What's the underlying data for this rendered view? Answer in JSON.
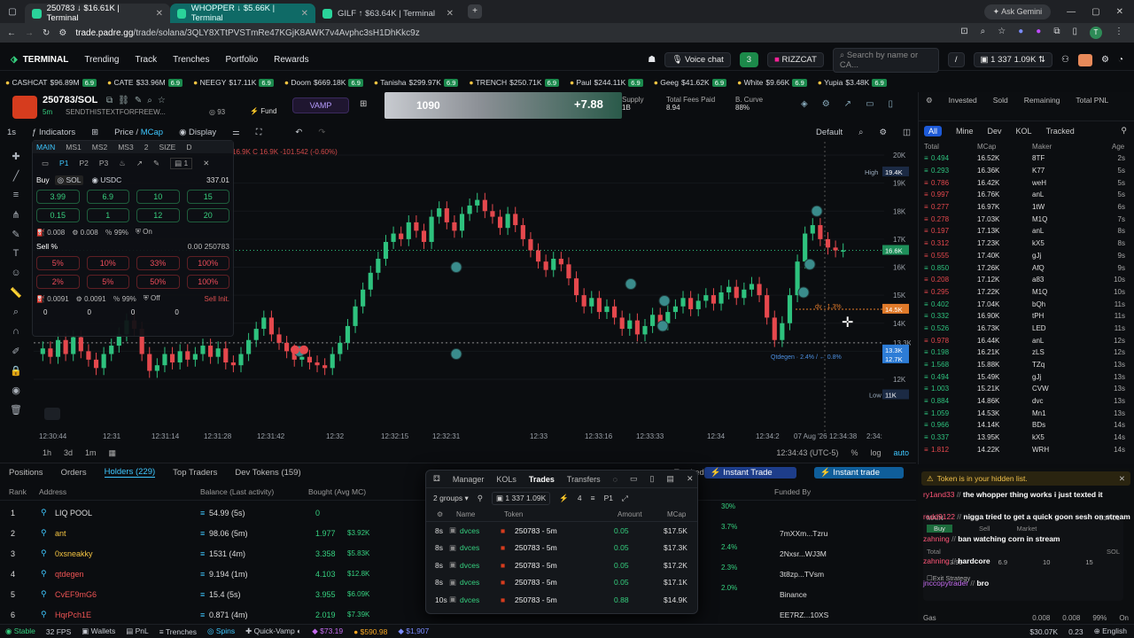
{
  "browser": {
    "tabs": [
      {
        "label": "250783 ↓ $16.61K | Terminal"
      },
      {
        "label": "WHOPPER ↓ $5.66K | Terminal"
      },
      {
        "label": "GILF ↑ $63.64K | Terminal"
      }
    ],
    "address_host": "trade.padre.gg",
    "address_path": "/trade/solana/3QLY8XTtPVSTmRe47KGjK8AWK7v4Avphc3sH1DhKkc9z",
    "ask_gemini": "Ask Gemini"
  },
  "nav": {
    "brand": "TERMINAL",
    "items": [
      "Trending",
      "Track",
      "Trenches",
      "Portfolio",
      "Rewards"
    ],
    "voice_chat": "Voice chat",
    "badge_count": "3",
    "profile_name": "RIZZCAT",
    "search_placeholder": "Search by name or CA...",
    "search_shortcut": "/",
    "wallet_count": "1",
    "sol_amount": "337",
    "usd_amount": "1.09K"
  },
  "ticker": [
    {
      "name": "CASHCAT",
      "mcap": "$96.89M",
      "pct": "6.9",
      "dir": "up"
    },
    {
      "name": "CATE",
      "mcap": "$33.96M",
      "pct": "6.9",
      "dir": "up"
    },
    {
      "name": "NEEGY",
      "mcap": "$17.11K",
      "pct": "6.9",
      "dir": "up"
    },
    {
      "name": "Doom",
      "mcap": "$669.18K",
      "pct": "6.9",
      "dir": "up"
    },
    {
      "name": "Tanisha",
      "mcap": "$299.97K",
      "pct": "6.9",
      "dir": "up"
    },
    {
      "name": "TRENCH",
      "mcap": "$250.71K",
      "pct": "6.9",
      "dir": "up"
    },
    {
      "name": "Paul",
      "mcap": "$244.11K",
      "pct": "6.9",
      "dir": "up"
    },
    {
      "name": "Geeg",
      "mcap": "$41.62K",
      "pct": "6.9",
      "dir": "up"
    },
    {
      "name": "White",
      "mcap": "$9.66K",
      "pct": "6.9",
      "dir": "up"
    },
    {
      "name": "Yupia",
      "mcap": "$3.48K",
      "pct": "6.9",
      "dir": "up"
    }
  ],
  "token": {
    "pair": "250783/SOL",
    "age": "5m",
    "ticker_line": "SENDTHISTEXTFORFREEW...",
    "holders_icon_count": "93",
    "fund": "Fund",
    "vamp": "VAMP",
    "overlay_value": "1090",
    "overlay_pct": "+7.88",
    "supply_label": "Supply",
    "supply_value": "1B",
    "fees_label": "Total Fees Paid",
    "fees_value": "8.94",
    "curve_label": "B. Curve",
    "curve_value": "88%"
  },
  "chart_toolbar": {
    "interval": "1s",
    "indicators": "Indicators",
    "price": "Price",
    "mcap": "MCap",
    "display": "Display",
    "default": "Default",
    "ohlc": "16.9K C 16.9K -101.542 (-0.60%)"
  },
  "chart_data": {
    "type": "candlestick",
    "y_ticks": [
      "20K",
      "19K",
      "18K",
      "17K",
      "16K",
      "15K",
      "14K",
      "13.3K",
      "13K",
      "12K"
    ],
    "x_ticks": [
      "12:30:44",
      "12:31",
      "12:31:14",
      "12:31:28",
      "12:31:42",
      "12:32",
      "12:32:15",
      "12:32:31",
      "12:33",
      "12:33:16",
      "12:33:33",
      "12:34",
      "12:34:2",
      "07 Aug '26",
      "12:34:38",
      "2:34:"
    ],
    "high_label": "High",
    "high_value": "19.4K",
    "low_label": "Low",
    "low_value": "11K",
    "current_price": "16.6K",
    "dev_line_label": "dv · 1.3%",
    "dev_line_price": "14.5K",
    "qtdegen_label": "Qtdegen · 2.4% / ← 0.8%",
    "blue_tag_1": "13.3K",
    "blue_tag_2": "12.7K",
    "utc_time": "12:34:43 (UTC-5)",
    "timeframes": [
      "1h",
      "3d",
      "1m"
    ],
    "log_label": "log",
    "auto_label": "auto",
    "pct_label": "%",
    "close_series": [
      13.1,
      12.8,
      13.4,
      12.9,
      13.5,
      13.0,
      12.7,
      12.4,
      12.9,
      13.2,
      13.6,
      14.1,
      13.8,
      12.9,
      12.3,
      12.5,
      12.9,
      12.6,
      13.0,
      12.7,
      12.9,
      13.2,
      12.8,
      13.1,
      12.6,
      12.5,
      12.9,
      13.4,
      13.8,
      14.2,
      13.6,
      13.3,
      13.0,
      12.7,
      12.8,
      12.6,
      12.5,
      12.4,
      12.9,
      13.3,
      13.9,
      14.6,
      15.2,
      15.8,
      16.3,
      16.9,
      17.2,
      17.0,
      17.6,
      17.3,
      16.9,
      17.8,
      18.1,
      17.6,
      17.3,
      17.9,
      18.2,
      18.4,
      18.0,
      17.8,
      17.4,
      17.9,
      17.5,
      17.0,
      16.6,
      16.2,
      15.9,
      16.3,
      16.1,
      15.6,
      15.0,
      14.6,
      14.9,
      14.4,
      14.6,
      14.2,
      13.8,
      14.1,
      13.6,
      13.9,
      14.3,
      14.0,
      14.4,
      14.6,
      14.9,
      14.5,
      14.8,
      15.0,
      14.7,
      15.1,
      15.3,
      14.9,
      15.2,
      15.4,
      15.0,
      14.2,
      13.4,
      14.0,
      15.0,
      16.2,
      17.2,
      17.5,
      17.0,
      16.7,
      16.6,
      16.6
    ]
  },
  "trade_panel": {
    "tabs": [
      "MAIN",
      "MS1",
      "MS2",
      "MS3",
      "2",
      "SIZE",
      "D"
    ],
    "presets": [
      "P1",
      "P2",
      "P3"
    ],
    "preset_count": "1",
    "buy_label": "Buy",
    "sol": "SOL",
    "usdc": "USDC",
    "balance": "337.01",
    "buy_amounts": [
      "3.99",
      "6.9",
      "10",
      "15",
      "0.15",
      "1",
      "12",
      "20"
    ],
    "buy_settings": [
      "0.008",
      "0.008",
      "99%",
      "On"
    ],
    "sell_label": "Sell %",
    "sell_balance": "0.00 250783",
    "sell_pcts": [
      "5%",
      "10%",
      "33%",
      "100%",
      "2%",
      "5%",
      "50%",
      "100%"
    ],
    "sell_settings": [
      "0.0091",
      "0.0091",
      "99%",
      "Off"
    ],
    "sell_init": "Sell Init.",
    "counters": [
      "0",
      "0",
      "0",
      "0"
    ]
  },
  "right_panel": {
    "headers": [
      "Invested",
      "Sold",
      "Remaining",
      "Total PNL"
    ],
    "filters": [
      "All",
      "Mine",
      "Dev",
      "KOL",
      "Tracked"
    ],
    "cols": [
      "Total",
      "MCap",
      "Maker",
      "Age"
    ],
    "rows": [
      {
        "total": "0.494",
        "mcap": "16.52K",
        "maker": "8TF",
        "age": "2s",
        "side": "buy"
      },
      {
        "total": "0.293",
        "mcap": "16.36K",
        "maker": "K77",
        "age": "5s",
        "side": "buy"
      },
      {
        "total": "0.786",
        "mcap": "16.42K",
        "maker": "weH",
        "age": "5s",
        "side": "sell"
      },
      {
        "total": "0.997",
        "mcap": "16.76K",
        "maker": "anL",
        "age": "5s",
        "side": "sell"
      },
      {
        "total": "0.277",
        "mcap": "16.97K",
        "maker": "1tW",
        "age": "6s",
        "side": "sell"
      },
      {
        "total": "0.278",
        "mcap": "17.03K",
        "maker": "M1Q",
        "age": "7s",
        "side": "sell"
      },
      {
        "total": "0.197",
        "mcap": "17.13K",
        "maker": "anL",
        "age": "8s",
        "side": "sell"
      },
      {
        "total": "0.312",
        "mcap": "17.23K",
        "maker": "kX5",
        "age": "8s",
        "side": "sell"
      },
      {
        "total": "0.555",
        "mcap": "17.40K",
        "maker": "gJj",
        "age": "9s",
        "side": "sell"
      },
      {
        "total": "0.850",
        "mcap": "17.26K",
        "maker": "AfQ",
        "age": "9s",
        "side": "buy"
      },
      {
        "total": "0.208",
        "mcap": "17.12K",
        "maker": "a83",
        "age": "10s",
        "side": "sell"
      },
      {
        "total": "0.295",
        "mcap": "17.22K",
        "maker": "M1Q",
        "age": "10s",
        "side": "sell"
      },
      {
        "total": "0.402",
        "mcap": "17.04K",
        "maker": "bQh",
        "age": "11s",
        "side": "buy"
      },
      {
        "total": "0.332",
        "mcap": "16.90K",
        "maker": "tPH",
        "age": "11s",
        "side": "buy"
      },
      {
        "total": "0.526",
        "mcap": "16.73K",
        "maker": "LED",
        "age": "11s",
        "side": "buy"
      },
      {
        "total": "0.978",
        "mcap": "16.44K",
        "maker": "anL",
        "age": "12s",
        "side": "sell"
      },
      {
        "total": "0.198",
        "mcap": "16.21K",
        "maker": "zLS",
        "age": "12s",
        "side": "buy"
      },
      {
        "total": "1.568",
        "mcap": "15.88K",
        "maker": "TZq",
        "age": "13s",
        "side": "buy"
      },
      {
        "total": "0.494",
        "mcap": "15.49K",
        "maker": "gJj",
        "age": "13s",
        "side": "buy"
      },
      {
        "total": "1.003",
        "mcap": "15.21K",
        "maker": "CVW",
        "age": "13s",
        "side": "buy"
      },
      {
        "total": "0.884",
        "mcap": "14.86K",
        "maker": "dvc",
        "age": "13s",
        "side": "buy"
      },
      {
        "total": "1.059",
        "mcap": "14.53K",
        "maker": "Mn1",
        "age": "13s",
        "side": "buy"
      },
      {
        "total": "0.966",
        "mcap": "14.14K",
        "maker": "BDs",
        "age": "14s",
        "side": "buy"
      },
      {
        "total": "0.337",
        "mcap": "13.95K",
        "maker": "kX5",
        "age": "14s",
        "side": "buy"
      },
      {
        "total": "1.812",
        "mcap": "14.22K",
        "maker": "WRH",
        "age": "14s",
        "side": "sell"
      }
    ]
  },
  "bottom": {
    "tabs": [
      "Positions",
      "Orders",
      "Holders (229)",
      "Top Traders",
      "Dev Tokens (159)"
    ],
    "tracked": "Tracked",
    "instant_trade": "Instant Trade",
    "instant_trade2": "Instant trade",
    "cols": [
      "Rank",
      "Address",
      "Balance (Last activity)",
      "Bought (Avg MC)",
      "Funded By"
    ],
    "holders": [
      {
        "rank": "1",
        "name": "LIQ POOL",
        "balance": "54.99 (5s)",
        "bought": "0",
        "bought_usd": "",
        "funded": ""
      },
      {
        "rank": "2",
        "name": "ant",
        "balance": "98.06 (5m)",
        "bought": "1.977",
        "bought_usd": "$3.92K",
        "funded": "7mXXm...Tzru"
      },
      {
        "rank": "3",
        "name": "0xsneakky",
        "balance": "1531 (4m)",
        "bought": "3.358",
        "bought_usd": "$5.83K",
        "funded": "2Nxsr...WJ3M"
      },
      {
        "rank": "4",
        "name": "qtdegen",
        "balance": "9.194 (1m)",
        "bought": "4.103",
        "bought_usd": "$12.8K",
        "funded": "3t8zp...TVsm"
      },
      {
        "rank": "5",
        "name": "CvEF9mG6",
        "balance": "15.4 (5s)",
        "bought": "3.955",
        "bought_usd": "$6.09K",
        "funded": "Binance"
      },
      {
        "rank": "6",
        "name": "HqrPch1E",
        "balance": "0.871 (4m)",
        "bought": "2.019",
        "bought_usd": "$7.39K",
        "funded": "EE7RZ...10XS"
      }
    ],
    "pcts": [
      "30%",
      "3.7%",
      "2.4%",
      "2.3%",
      "2.0%"
    ]
  },
  "popup": {
    "tabs": [
      "Manager",
      "KOLs",
      "Trades",
      "Transfers"
    ],
    "groups": "2 groups",
    "wallets": "1",
    "sol": "337",
    "usd": "1.09K",
    "count": "4",
    "p": "P1",
    "cols": [
      "Name",
      "Token",
      "Amount",
      "MCap"
    ],
    "rows": [
      {
        "age": "8s",
        "name": "dvces",
        "token": "250783 - 5m",
        "amount": "0.05",
        "mcap": "$17.5K"
      },
      {
        "age": "8s",
        "name": "dvces",
        "token": "250783 - 5m",
        "amount": "0.05",
        "mcap": "$17.3K"
      },
      {
        "age": "8s",
        "name": "dvces",
        "token": "250783 - 5m",
        "amount": "0.05",
        "mcap": "$17.2K"
      },
      {
        "age": "8s",
        "name": "dvces",
        "token": "250783 - 5m",
        "amount": "0.05",
        "mcap": "$17.1K"
      },
      {
        "age": "10s",
        "name": "dvces",
        "token": "250783 - 5m",
        "amount": "0.88",
        "mcap": "$14.9K"
      }
    ]
  },
  "chat": {
    "hidden_notice": "Token is in your hidden list.",
    "messages": [
      {
        "user": "ry1and33",
        "text": "the whopper thing works i just texted it"
      },
      {
        "user": "rodd9122",
        "text": "nigga tried to get a quick goon sesh on stream"
      },
      {
        "user": "zahning",
        "text": "ban watching corn in stream"
      },
      {
        "user": "zahning",
        "text": "hardcore"
      },
      {
        "user": "jnccopytrader",
        "text": "bro"
      }
    ],
    "main": "MAIN",
    "balance": "337.01",
    "buy": "Buy",
    "sell": "Sell",
    "market": "Market",
    "total": "Total",
    "sol": "SOL",
    "amounts": [
      "3.99",
      "6.9",
      "10",
      "15"
    ],
    "exit_strategy": "Exit Strategy",
    "gas": "Gas",
    "gas_vals": [
      "0.008",
      "0.008",
      "99%",
      "On"
    ]
  },
  "status": {
    "stable": "Stable",
    "fps": "32 FPS",
    "items": [
      "Wallets",
      "PnL",
      "Trenches",
      "Spins",
      "Quick-Vamp"
    ],
    "prices": [
      "$73.19",
      "$590.98",
      "$1,907"
    ],
    "right": [
      "$30.07K",
      "0.23",
      "English"
    ]
  },
  "colors": {
    "up": "#2ec27e",
    "down": "#e5484d",
    "accent": "#3ec7ff",
    "teal": "#0f6a66"
  }
}
